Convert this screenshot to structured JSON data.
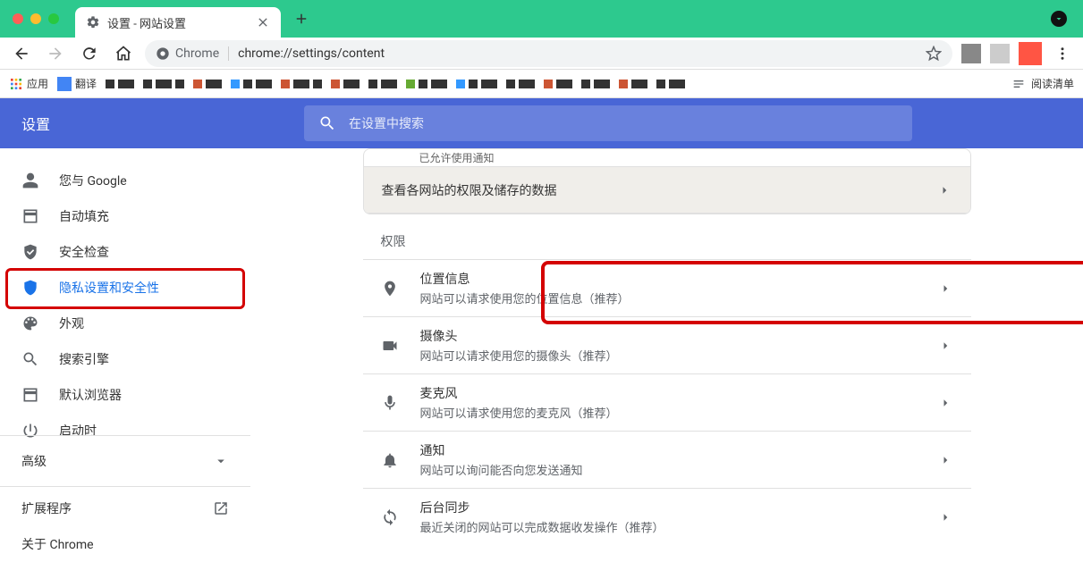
{
  "window": {
    "tab_title": "设置 - 网站设置"
  },
  "toolbar": {
    "origin_label": "Chrome",
    "url": "chrome://settings/content"
  },
  "bookmarks": {
    "apps_label": "应用",
    "translate_label": "翻译",
    "reading_list_label": "阅读清单"
  },
  "settings_header": {
    "title": "设置",
    "search_placeholder": "在设置中搜索"
  },
  "sidebar": {
    "items": [
      {
        "label": "您与 Google"
      },
      {
        "label": "自动填充"
      },
      {
        "label": "安全检查"
      },
      {
        "label": "隐私设置和安全性"
      },
      {
        "label": "外观"
      },
      {
        "label": "搜索引擎"
      },
      {
        "label": "默认浏览器"
      },
      {
        "label": "启动时"
      }
    ],
    "advanced_label": "高级",
    "extensions_label": "扩展程序",
    "about_label": "关于 Chrome"
  },
  "main": {
    "partial_visible_sub": "已允许使用通知",
    "view_all_sites_label": "查看各网站的权限及储存的数据",
    "permissions_section_title": "权限",
    "permissions": [
      {
        "title": "位置信息",
        "sub": "网站可以请求使用您的位置信息（推荐）"
      },
      {
        "title": "摄像头",
        "sub": "网站可以请求使用您的摄像头（推荐）"
      },
      {
        "title": "麦克风",
        "sub": "网站可以请求使用您的麦克风（推荐）"
      },
      {
        "title": "通知",
        "sub": "网站可以询问能否向您发送通知"
      },
      {
        "title": "后台同步",
        "sub": "最近关闭的网站可以完成数据收发操作（推荐）"
      }
    ]
  }
}
